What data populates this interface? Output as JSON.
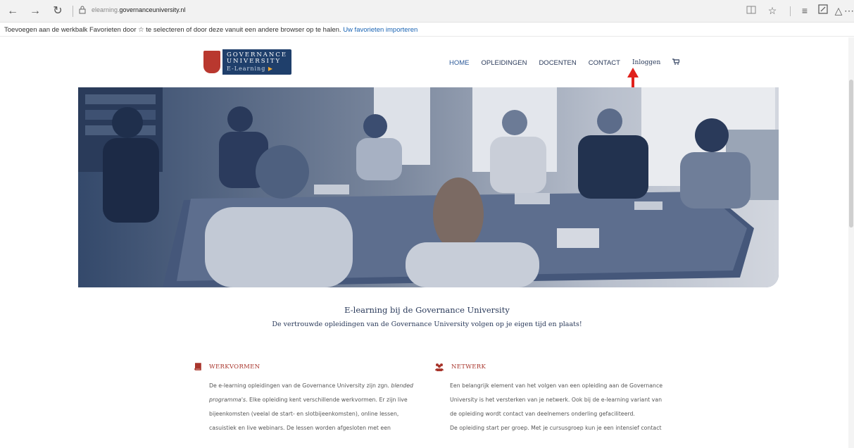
{
  "browser": {
    "url_prefix": "elearning.",
    "url_domain": "governanceuniversity.nl",
    "favorites_bar_text": "Toevoegen aan de werkbalk Favorieten door ☆ te selecteren of door deze vanuit een andere browser op te halen.",
    "favorites_bar_link": "Uw favorieten importeren"
  },
  "logo": {
    "line1": "GOVERNANCE",
    "line2": "UNIVERSITY",
    "line3": "E-Learning"
  },
  "nav": {
    "items": [
      "HOME",
      "OPLEIDINGEN",
      "DOCENTEN",
      "CONTACT"
    ],
    "login": "Inloggen"
  },
  "intro": {
    "title": "E-learning bij de Governance University",
    "subtitle": "De vertrouwde opleidingen van de Governance University volgen op je eigen tijd en plaats!"
  },
  "werkvormen": {
    "heading": "WERKVORMEN",
    "line1_pre": "De e-learning opleidingen van de Governance University zijn zgn. ",
    "line1_em": "blended",
    "line2_em": "programma's",
    "line2_post": ". Elke opleiding kent verschillende werkvormen. Er zijn live",
    "line3": "bijeenkomsten (veelal de start- en slotbijeenkomsten), online lessen,",
    "line4": "casuistiek en live webinars. De lessen worden afgesloten met een"
  },
  "netwerk": {
    "heading": "NETWERK",
    "line1": "Een belangrijk element van het volgen van een opleiding aan de Governance",
    "line2": "University is het versterken van je netwerk. Ook bij de e-learning variant van",
    "line3": "de opleiding wordt contact van deelnemers onderling gefaciliteerd.",
    "line4": "De opleiding start per groep. Met je cursusgroep kun je een intensief contact"
  },
  "colors": {
    "accent_red": "#a8352c",
    "navy": "#1f3f6b",
    "hero_tint": "#5b6f8e"
  }
}
